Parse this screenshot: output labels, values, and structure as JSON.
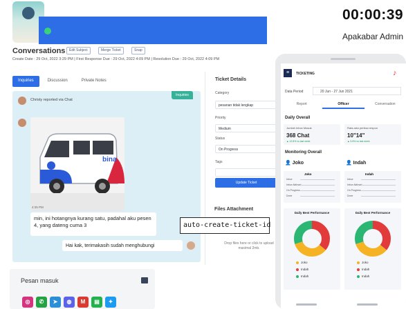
{
  "header": {
    "timer": "00:00:39",
    "greeting": "Apakabar Admin"
  },
  "conversations": {
    "title": "Conversations",
    "actions": [
      "Edit Subject",
      "Merge Ticket",
      "Snap"
    ],
    "meta": "Create Date : 29 Oct, 2022 3:29 PM   |   First Response Due : 29 Oct, 2022 4:09 PM   |   Resolution Due : 29 Oct, 2022 4:09 PM",
    "tabs": [
      "Inquiries",
      "Discussion",
      "Private Notes"
    ],
    "inquiry_tag": "Inquiries",
    "author": "Christy  reported via Chat",
    "image_time": "4:25 PM",
    "image_brand": "bina",
    "messages": [
      "min, ini hotangnya kurang satu, padahal aku pesen 4, yang dateng cuma 3",
      "Hai kak, terimakasih sudah menghubungi"
    ],
    "tooltip": "auto-create-ticket-id"
  },
  "ticket": {
    "title": "Ticket Details",
    "fields": [
      {
        "label": "Category",
        "value": "pesanan tidak lengkap"
      },
      {
        "label": "Priority",
        "value": "Medium"
      },
      {
        "label": "Status",
        "value": "On Progress"
      },
      {
        "label": "Tags",
        "value": ""
      }
    ],
    "update_button": "Update Ticket",
    "files_title": "Files Attachment",
    "drop_text": "Drop files here or click to upload maximal 2mb."
  },
  "pesan": {
    "title": "Pesan masuk",
    "channels": [
      {
        "icon": "instagram-icon",
        "glyph": "◎",
        "color": "#d6337e"
      },
      {
        "icon": "whatsapp-icon",
        "glyph": "✆",
        "color": "#25a244"
      },
      {
        "icon": "telegram-icon",
        "glyph": "➤",
        "color": "#2c8ed6"
      },
      {
        "icon": "messenger-icon",
        "glyph": "◍",
        "color": "#5b63e8"
      },
      {
        "icon": "gmail-icon",
        "glyph": "M",
        "color": "#d93b30"
      },
      {
        "icon": "line-icon",
        "glyph": "▤",
        "color": "#22b14c"
      },
      {
        "icon": "twitter-icon",
        "glyph": "✦",
        "color": "#1d9bf0"
      }
    ]
  },
  "phone": {
    "app_title": "TICKETING",
    "period_label": "Data Period",
    "period_value": "20 Jun - 27 Jun 2021",
    "tabs": [
      "Report",
      "Officer",
      "Conversation"
    ],
    "active_tab": 1,
    "daily_overall": "Daily Overall",
    "metrics": [
      {
        "label": "Jumlah Inbox Masuk",
        "value": "368 Chat",
        "growth": "▲ 12.8% vs last week"
      },
      {
        "label": "Rata-rata periksa respon",
        "value": "10\"14\"",
        "growth": "▲ 5.8% vs last week"
      }
    ],
    "monitoring": "Monitoring Overall",
    "agents": [
      {
        "name": "Joko",
        "rows": [
          "Inbox",
          "Inbox Aktivasi",
          "On Progress",
          "Done"
        ]
      },
      {
        "name": "Indah",
        "rows": [
          "Inbox",
          "Inbox Aktivasi",
          "On Progress",
          "Done"
        ]
      }
    ],
    "performance_title": "Daily Best Performance",
    "legend": [
      "Joko",
      "Indah",
      "Indah"
    ],
    "pie_colors": [
      "#e23b3b",
      "#f5b323",
      "#2bb673"
    ]
  }
}
